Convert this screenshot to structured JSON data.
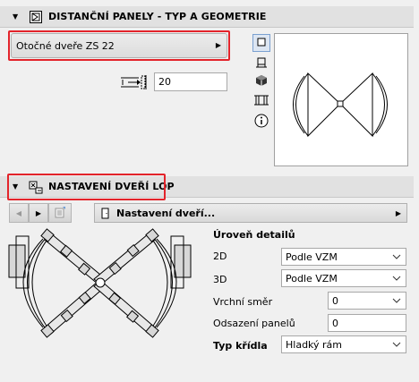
{
  "section1": {
    "title": "DISTANČNÍ PANELY - TYP A GEOMETRIE",
    "icon": "panel-settings-icon"
  },
  "door_type": {
    "value": "Otočné dveře ZS 22"
  },
  "offset_input": {
    "value": "20",
    "icon": "dimension-offset-icon"
  },
  "view_buttons": [
    "plan-view-icon",
    "floor-plan-icon",
    "3d-view-icon",
    "section-view-icon",
    "info-icon"
  ],
  "section2": {
    "title": "NASTAVENÍ DVEŘÍ LOP",
    "icon": "door-settings-icon"
  },
  "toolbar": {
    "prev": "prev-arrow-icon",
    "next": "next-arrow-icon",
    "page_icon": "page-icon",
    "dropdown_label": "Nastavení dveří...",
    "door_icon": "door-icon"
  },
  "settings": {
    "detail_level_label": "Úroveň detailů",
    "row_2d_label": "2D",
    "row_2d_value": "Podle VZM",
    "row_3d_label": "3D",
    "row_3d_value": "Podle VZM",
    "top_dir_label": "Vrchní směr",
    "top_dir_value": "0",
    "panel_offset_label": "Odsazení panelů",
    "panel_offset_value": "0",
    "wing_type_label": "Typ křídla",
    "wing_type_value": "Hladký rám"
  },
  "colors": {
    "highlight": "#e3242b",
    "header_bg": "#e1e1e1",
    "active_btn": "#dde6f2",
    "symbol_fill": "#d7d7d7"
  }
}
